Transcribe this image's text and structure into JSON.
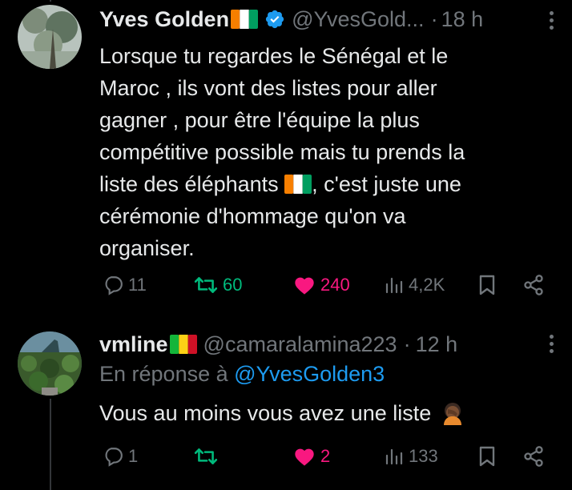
{
  "tweets": [
    {
      "author_name": "Yves Golden",
      "author_flag": "ci-flag-icon",
      "verified": true,
      "handle": "@YvesGold...",
      "separator": "·",
      "time": "18 h",
      "text_lines": [
        "Lorsque tu regardes le Sénégal et le",
        "Maroc , ils vont des listes pour aller",
        "gagner , pour être l'équipe la plus",
        "compétitive possible mais tu prends la",
        "liste des éléphants",
        ", c'est juste une",
        "cérémonie d'hommage qu'on va",
        "organiser."
      ],
      "actions": {
        "replies": "11",
        "retweets": "60",
        "likes": "240",
        "views": "4,2K"
      }
    },
    {
      "author_name": "vmline",
      "author_flag": "ml-flag-icon",
      "handle": "@camaralamina223",
      "separator": "·",
      "time": "12 h",
      "reply_prefix": "En réponse à",
      "reply_mention": "@YvesGolden3",
      "text": "Vous au moins vous avez une liste",
      "emoji": "facepalm-emoji-icon",
      "actions": {
        "replies": "1",
        "retweets": "",
        "likes": "2",
        "views": "133"
      }
    }
  ],
  "colors": {
    "background": "#000000",
    "text": "#e7e9ea",
    "muted": "#71767b",
    "link": "#1d9bf0",
    "retweet_active": "#00ba7c",
    "like_active": "#f91880",
    "verified": "#1d9bf0"
  }
}
